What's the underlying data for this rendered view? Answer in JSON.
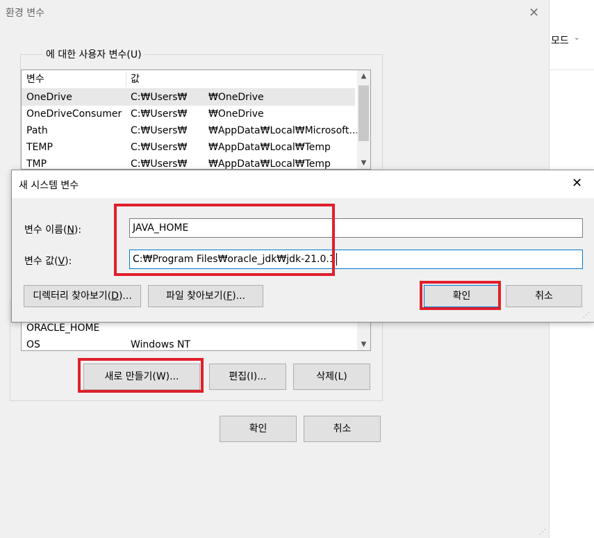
{
  "env_window": {
    "title": "환경 변수",
    "close_glyph": "✕",
    "user_group_label": "에 대한 사용자 변수(U)",
    "columns": [
      "변수",
      "값"
    ],
    "user_vars": [
      {
        "name": "OneDrive",
        "val_a": "C:₩Users₩",
        "val_b": "₩OneDrive"
      },
      {
        "name": "OneDriveConsumer",
        "val_a": "C:₩Users₩",
        "val_b": "₩OneDrive"
      },
      {
        "name": "Path",
        "val_a": "C:₩Users₩",
        "val_b": "₩AppData₩Local₩Microsoft…"
      },
      {
        "name": "TEMP",
        "val_a": "C:₩Users₩",
        "val_b": "₩AppData₩Local₩Temp"
      },
      {
        "name": "TMP",
        "val_a": "C:₩Users₩",
        "val_b": "₩AppData₩Local₩Temp"
      }
    ],
    "sys_vars": [
      {
        "name": "ORACLE_HOME",
        "val_a": ""
      },
      {
        "name": "OS",
        "val_a": "Windows NT"
      }
    ],
    "buttons": {
      "new": "새로 만들기(W)...",
      "edit": "편집(I)...",
      "delete": "삭제(L)",
      "ok": "확인",
      "cancel": "취소"
    }
  },
  "right_panel": {
    "mode_label": "모드",
    "chevron": "⌄"
  },
  "dialog": {
    "title": "새 시스템 변수",
    "close_glyph": "✕",
    "name_label_pre": "변수 이름(",
    "name_label_key": "N",
    "name_label_post": "):",
    "value_label_pre": "변수 값(",
    "value_label_key": "V",
    "value_label_post": "):",
    "name_value": "JAVA_HOME",
    "value_value": "C:₩Program Files₩oracle_jdk₩jdk-21.0.1",
    "browse_dir_pre": "디렉터리 찾아보기(",
    "browse_dir_key": "D",
    "browse_dir_post": ")...",
    "browse_file_pre": "파일 찾아보기(",
    "browse_file_key": "F",
    "browse_file_post": ")...",
    "ok": "확인",
    "cancel": "취소"
  },
  "colors": {
    "highlight_red": "#e0202a",
    "accent_blue": "#0078d7"
  }
}
